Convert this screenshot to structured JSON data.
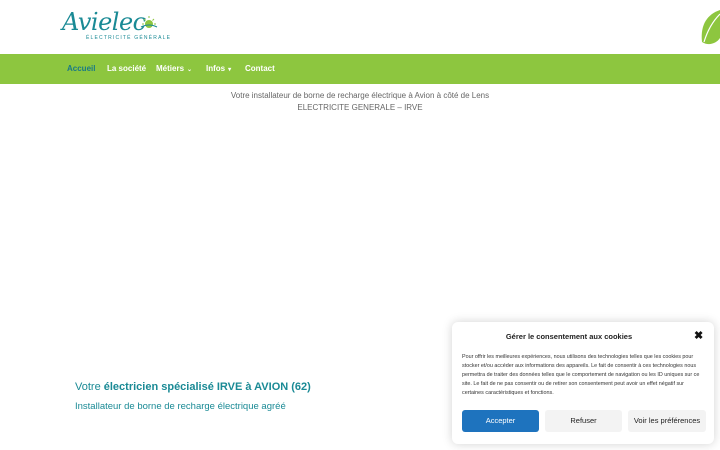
{
  "brand": {
    "logo_name": "Avielec",
    "logo_subtitle": "ÉLECTRICITÉ GÉNÉRALE"
  },
  "nav": {
    "items": [
      {
        "label": "Accueil",
        "active": true
      },
      {
        "label": "La société"
      },
      {
        "label": "Métiers",
        "caret": "⌄"
      },
      {
        "label": "Infos",
        "caret": "▾"
      },
      {
        "label": "Contact"
      }
    ]
  },
  "tagline": {
    "line1": "Votre installateur de borne de recharge électrique à Avion à côté de Lens",
    "line2": "ELECTRICITE GENERALE – IRVE"
  },
  "hero": {
    "prefix": "Votre ",
    "bold": "électricien spécialisé IRVE à AVION",
    "suffix": " (62)",
    "subtitle": "Installateur de borne de recharge électrique agréé"
  },
  "cookie": {
    "title": "Gérer le consentement aux cookies",
    "body": "Pour offrir les meilleures expériences, nous utilisons des technologies telles que les cookies pour stocker et/ou accéder aux informations des appareils. Le fait de consentir à ces technologies nous permettra de traiter des données telles que le comportement de navigation ou les ID uniques sur ce site. Le fait de ne pas consentir ou de retirer son consentement peut avoir un effet négatif sur certaines caractéristiques et fonctions.",
    "accept": "Accepter",
    "refuse": "Refuser",
    "prefs": "Voir les préférences",
    "close_glyph": "✖"
  },
  "colors": {
    "nav_bg": "#8dc63f",
    "brand_teal": "#1a8a95",
    "accept_bg": "#1e73be"
  }
}
